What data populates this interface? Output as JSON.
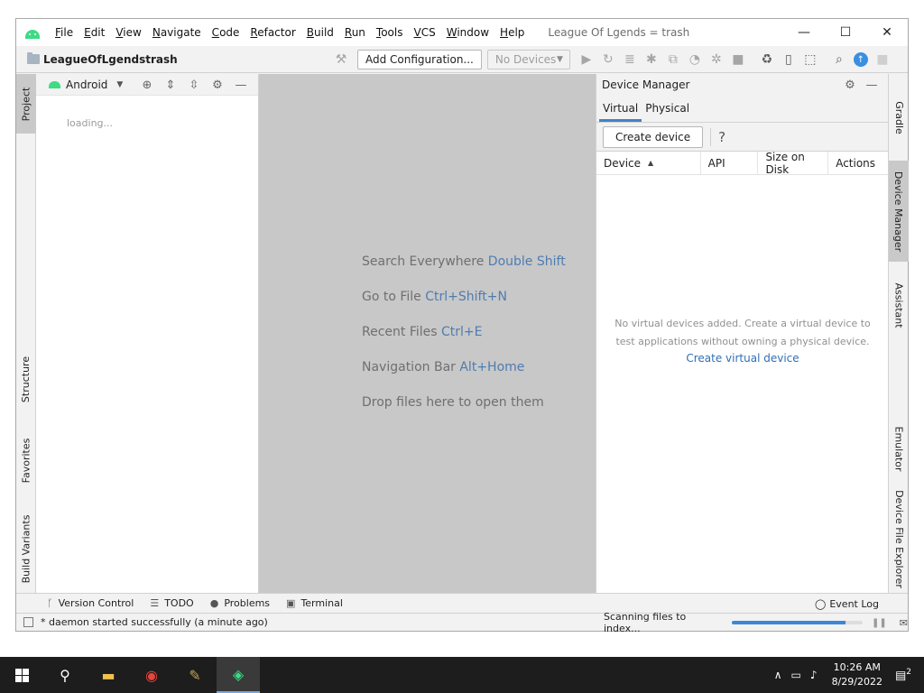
{
  "window": {
    "title": "League Of Lgends = trash",
    "menu": [
      {
        "mnemonic": "F",
        "rest": "ile"
      },
      {
        "mnemonic": "E",
        "rest": "dit"
      },
      {
        "mnemonic": "V",
        "rest": "iew"
      },
      {
        "mnemonic": "N",
        "rest": "avigate"
      },
      {
        "mnemonic": "C",
        "rest": "ode"
      },
      {
        "mnemonic": "R",
        "rest": "efactor"
      },
      {
        "mnemonic": "B",
        "rest": "uild"
      },
      {
        "mnemonic": "R",
        "rest": "un"
      },
      {
        "mnemonic": "T",
        "rest": "ools"
      },
      {
        "mnemonic": "V",
        "rest": "CS"
      },
      {
        "mnemonic": "W",
        "rest": "indow"
      },
      {
        "mnemonic": "H",
        "rest": "elp"
      }
    ],
    "controls": {
      "minimize": "—",
      "maximize": "☐",
      "close": "✕"
    }
  },
  "navbar": {
    "project_name": "LeagueOfLgendstrash",
    "add_configuration": "Add Configuration...",
    "devices": "No Devices"
  },
  "left_strip": {
    "project": "Project",
    "structure": "Structure",
    "favorites": "Favorites",
    "build_variants": "Build Variants"
  },
  "project_panel": {
    "view": "Android",
    "loading": "loading..."
  },
  "editor": {
    "hints": [
      {
        "label": "Search Everywhere",
        "key": "Double Shift"
      },
      {
        "label": "Go to File",
        "key": "Ctrl+Shift+N"
      },
      {
        "label": "Recent Files",
        "key": "Ctrl+E"
      },
      {
        "label": "Navigation Bar",
        "key": "Alt+Home"
      },
      {
        "label": "Drop files here to open them",
        "key": ""
      }
    ]
  },
  "device_manager": {
    "title": "Device Manager",
    "tabs": [
      "Virtual",
      "Physical"
    ],
    "create_device": "Create device",
    "help": "?",
    "columns": [
      "Device",
      "API",
      "Size on Disk",
      "Actions"
    ],
    "empty_message": "No virtual devices added. Create a virtual device to test applications without owning a physical device.",
    "create_link": "Create virtual device"
  },
  "right_strip": {
    "gradle": "Gradle",
    "device_manager": "Device Manager",
    "assistant": "Assistant",
    "emulator": "Emulator",
    "device_file_explorer": "Device File Explorer"
  },
  "bottom_tools": {
    "version_control": "Version Control",
    "todo": "TODO",
    "problems": "Problems",
    "terminal": "Terminal",
    "event_log": "Event Log"
  },
  "status": {
    "message": "* daemon started successfully (a minute ago)",
    "scanning": "Scanning files to index...",
    "progress": 0.87
  },
  "taskbar": {
    "time": "10:26 AM",
    "date": "8/29/2022",
    "notifications": "2"
  }
}
